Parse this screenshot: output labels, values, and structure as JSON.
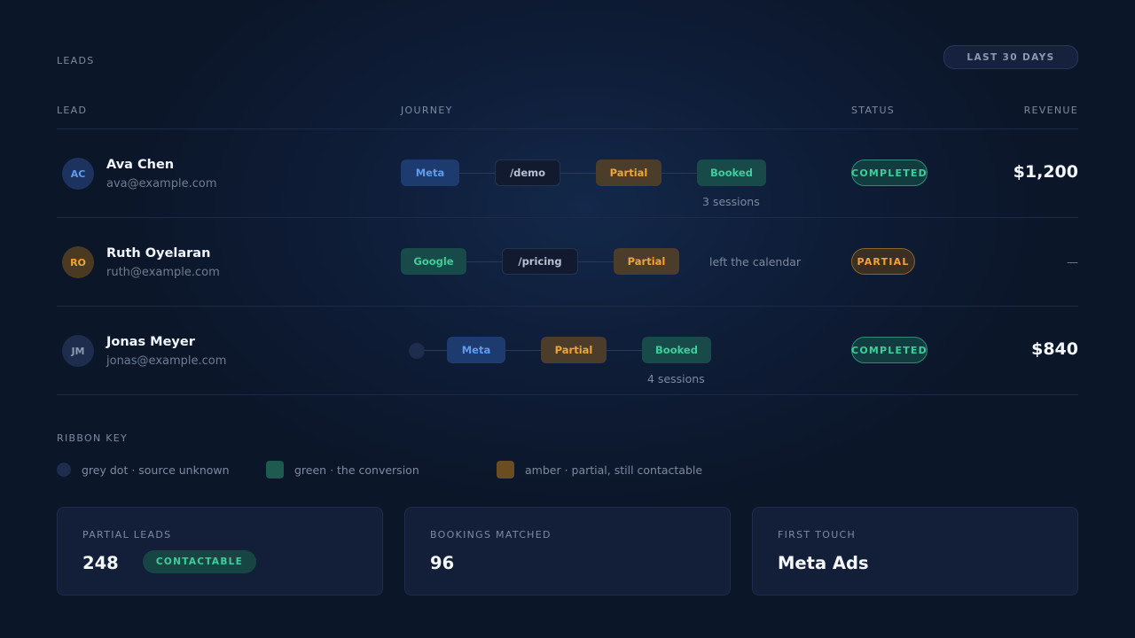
{
  "header": {
    "section_title": "LEADS",
    "range_button": "LAST 30 DAYS"
  },
  "columns": {
    "lead": "LEAD",
    "journey": "JOURNEY",
    "status": "STATUS",
    "revenue": "REVENUE"
  },
  "leads": [
    {
      "initials": "AC",
      "name": "Ava Chen",
      "email": "ava@example.com",
      "journey": [
        "Meta",
        "/demo",
        "Partial",
        "Booked"
      ],
      "sessions": "3 sessions",
      "status": "COMPLETED",
      "revenue": "$1,200"
    },
    {
      "initials": "RO",
      "name": "Ruth Oyelaran",
      "email": "ruth@example.com",
      "journey": [
        "Google",
        "/pricing",
        "Partial"
      ],
      "note": "left the calendar",
      "status": "PARTIAL",
      "revenue": "—"
    },
    {
      "initials": "JM",
      "name": "Jonas Meyer",
      "email": "jonas@example.com",
      "journey": [
        "Meta",
        "Partial",
        "Booked"
      ],
      "sessions": "4 sessions",
      "status": "COMPLETED",
      "revenue": "$840"
    }
  ],
  "ribbon_key": {
    "title": "RIBBON KEY",
    "items": [
      "grey dot · source unknown",
      "green · the conversion",
      "amber · partial, still contactable"
    ]
  },
  "stats": [
    {
      "label": "PARTIAL LEADS",
      "value": "248",
      "badge": "CONTACTABLE"
    },
    {
      "label": "BOOKINGS MATCHED",
      "value": "96"
    },
    {
      "label": "FIRST TOUCH",
      "value": "Meta Ads"
    }
  ],
  "colors": {
    "background": "#0b1629",
    "meta_blue": "#5f9bf0",
    "conversion_green": "#3ccf9c",
    "partial_amber": "#f2a532"
  }
}
